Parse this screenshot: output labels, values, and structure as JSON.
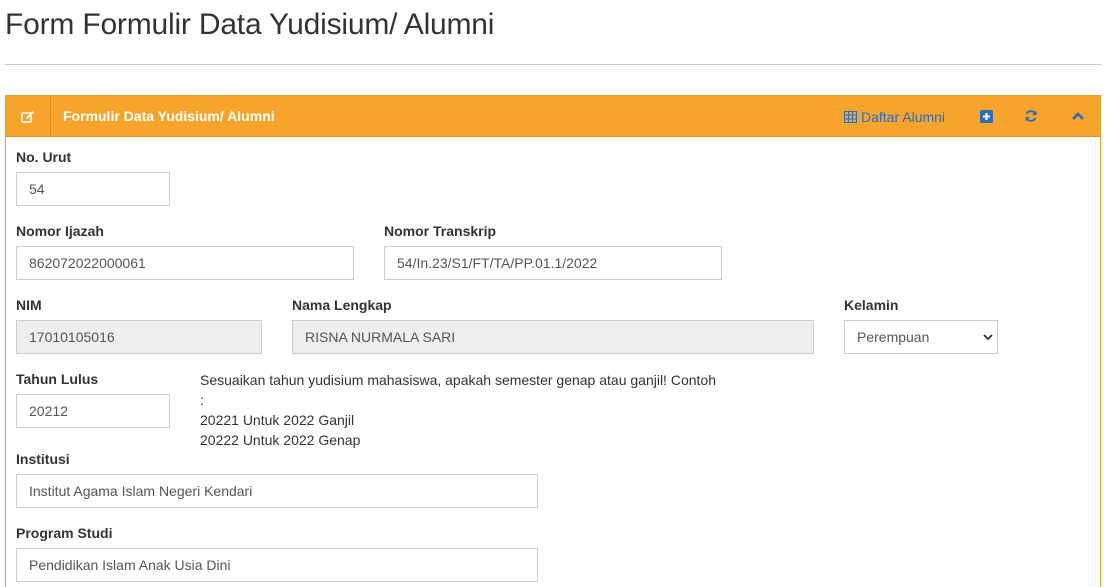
{
  "page": {
    "title": "Form Formulir Data Yudisium/ Alumni"
  },
  "panel": {
    "heading": "Formulir Data Yudisium/ Alumni",
    "daftar_alumni_label": "Daftar Alumni",
    "colors": {
      "header_bg": "#f6a42b",
      "link": "#2a6ebb"
    }
  },
  "form": {
    "no_urut": {
      "label": "No. Urut",
      "value": "54"
    },
    "nomor_ijazah": {
      "label": "Nomor Ijazah",
      "value": "862072022000061"
    },
    "nomor_transkrip": {
      "label": "Nomor Transkrip",
      "value": "54/In.23/S1/FT/TA/PP.01.1/2022"
    },
    "nim": {
      "label": "NIM",
      "value": "17010105016"
    },
    "nama_lengkap": {
      "label": "Nama Lengkap",
      "value": "RISNA NURMALA SARI"
    },
    "kelamin": {
      "label": "Kelamin",
      "selected": "Perempuan"
    },
    "tahun_lulus": {
      "label": "Tahun Lulus",
      "value": "20212"
    },
    "tahun_hint": {
      "line1": "Sesuaikan tahun yudisium mahasiswa, apakah semester genap atau ganjil! Contoh",
      "line2": ":",
      "line3": "20221 Untuk 2022 Ganjil",
      "line4": "20222 Untuk 2022 Genap"
    },
    "institusi": {
      "label": "Institusi",
      "value": "Institut Agama Islam Negeri Kendari"
    },
    "program_studi": {
      "label": "Program Studi",
      "value": "Pendidikan Islam Anak Usia Dini"
    }
  }
}
